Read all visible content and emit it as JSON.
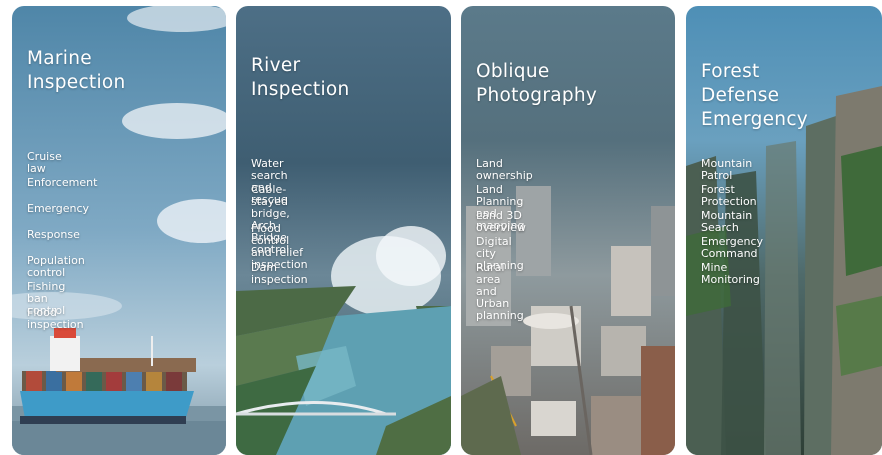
{
  "cards": [
    {
      "title": "Marine\nInspection",
      "items": [
        "Cruise law",
        "Enforcement",
        "Emergency",
        "Response",
        "Population control",
        "Fishing ban control",
        "Flood inspection"
      ]
    },
    {
      "title": "River\nInspection",
      "items": [
        "Water search and rescue",
        "Cable-stayed bridge,\nArch Bridge control",
        "Flood control and relief\ninspection",
        "Dam inspection"
      ]
    },
    {
      "title": "Oblique\nPhotography",
      "items": [
        "Land ownership",
        "Land Planning and mapping",
        "Land 3D overview",
        "Digital city planning",
        "Rural area and Urban\nplanning"
      ]
    },
    {
      "title": "Forest\nDefense\nEmergency",
      "items": [
        "Mountain Patrol",
        "Forest Protection",
        "Mountain Search",
        "Emergency Command",
        "Mine Monitoring"
      ]
    }
  ]
}
